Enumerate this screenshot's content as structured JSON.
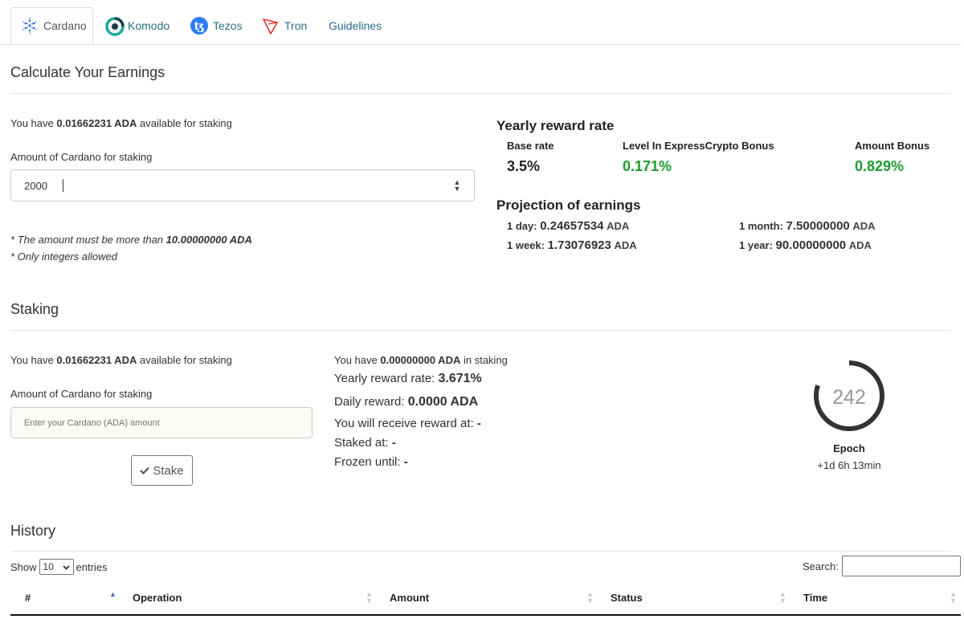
{
  "tabs": [
    {
      "label": "Cardano",
      "icon": "cardano-icon",
      "active": true
    },
    {
      "label": "Komodo",
      "icon": "komodo-icon",
      "active": false
    },
    {
      "label": "Tezos",
      "icon": "tezos-icon",
      "active": false
    },
    {
      "label": "Tron",
      "icon": "tron-icon",
      "active": false
    },
    {
      "label": "Guidelines",
      "active": false
    }
  ],
  "calc": {
    "title": "Calculate Your Earnings",
    "available": {
      "prefix": "You have",
      "value": "0.01662231 ADA",
      "suffix": "available for staking"
    },
    "amount_label": "Amount of Cardano for staking",
    "amount_value": "2000",
    "note_min_prefix": "* The amount must be more than",
    "note_min_value": "10.00000000 ADA",
    "note_int": "* Only integers allowed"
  },
  "rates": {
    "title": "Yearly reward rate",
    "base_label": "Base rate",
    "base_value": "3.5%",
    "level_label": "Level In ExpressCrypto Bonus",
    "level_value": "0.171%",
    "amount_label": "Amount Bonus",
    "amount_value": "0.829%"
  },
  "projection": {
    "title": "Projection of earnings",
    "day_label": "1 day:",
    "day_value": "0.24657534",
    "day_unit": "ADA",
    "week_label": "1 week:",
    "week_value": "1.73076923",
    "week_unit": "ADA",
    "month_label": "1 month:",
    "month_value": "7.50000000",
    "month_unit": "ADA",
    "year_label": "1 year:",
    "year_value": "90.00000000",
    "year_unit": "ADA"
  },
  "staking": {
    "title": "Staking",
    "available": {
      "prefix": "You have",
      "value": "0.01662231 ADA",
      "suffix": "available for staking"
    },
    "amount_label": "Amount of Cardano for staking",
    "amount_placeholder": "Enter your Cardano (ADA) amount",
    "stake_button": "Stake",
    "in_staking": {
      "prefix": "You have",
      "value": "0.00000000 ADA",
      "suffix": "in staking"
    },
    "yearly_label": "Yearly reward rate:",
    "yearly_value": "3.671%",
    "daily_label": "Daily reward:",
    "daily_value": "0.0000 ADA",
    "receive_label": "You will receive reward at:",
    "receive_value": "-",
    "staked_label": "Staked at:",
    "staked_value": "-",
    "frozen_label": "Frozen until:",
    "frozen_value": "-"
  },
  "epoch": {
    "number": "242",
    "label": "Epoch",
    "remaining": "+1d 6h 13min",
    "progress": 0.8
  },
  "history": {
    "title": "History",
    "show_label": "Show",
    "entries_value": "10",
    "entries_label": "entries",
    "search_label": "Search:",
    "columns": [
      "#",
      "Operation",
      "Amount",
      "Status",
      "Time"
    ]
  },
  "colors": {
    "accent_link": "#2b6c8a",
    "green": "#1e9b2e",
    "epoch_ring": "#333333"
  }
}
